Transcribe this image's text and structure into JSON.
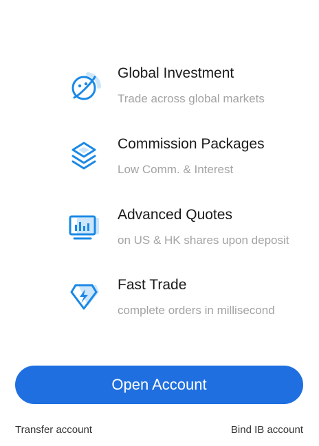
{
  "colors": {
    "accent": "#1f6fe0",
    "icon_blue": "#1a88e6",
    "icon_light": "#cde6fb",
    "title_text": "#1a1a1a",
    "desc_text": "#a3a3a3"
  },
  "features": [
    {
      "icon": "globe-icon",
      "title": "Global Investment",
      "desc": "Trade across global markets"
    },
    {
      "icon": "layers-icon",
      "title": "Commission Packages",
      "desc": "Low Comm. & Interest"
    },
    {
      "icon": "chart-monitor-icon",
      "title": "Advanced Quotes",
      "desc": "on US & HK shares upon deposit"
    },
    {
      "icon": "diamond-bolt-icon",
      "title": "Fast Trade",
      "desc": "complete orders in millisecond"
    }
  ],
  "actions": {
    "open_account": "Open Account",
    "transfer_account": "Transfer account",
    "bind_ib_account": "Bind IB account"
  }
}
